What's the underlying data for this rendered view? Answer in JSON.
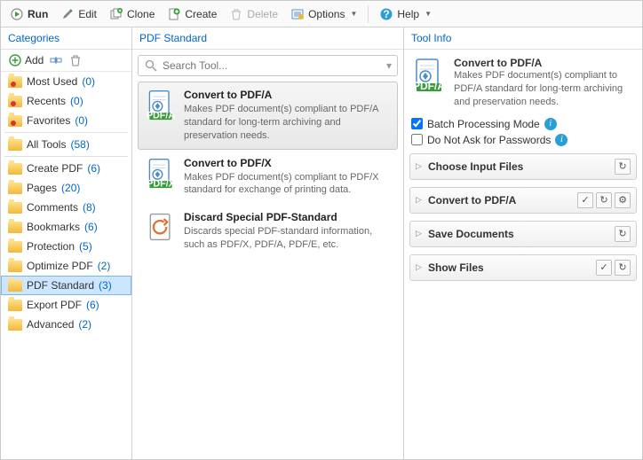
{
  "toolbar": {
    "run": "Run",
    "edit": "Edit",
    "clone": "Clone",
    "create": "Create",
    "delete": "Delete",
    "options": "Options",
    "help": "Help"
  },
  "panels": {
    "categories": "Categories",
    "standard": "PDF Standard",
    "info": "Tool Info"
  },
  "cat": {
    "add": "Add"
  },
  "categories": [
    {
      "label": "Most Used",
      "count": 0,
      "special": true
    },
    {
      "label": "Recents",
      "count": 0,
      "special": true
    },
    {
      "label": "Favorites",
      "count": 0,
      "special": true
    },
    {
      "label": "All Tools",
      "count": 58
    },
    {
      "label": "Create PDF",
      "count": 6
    },
    {
      "label": "Pages",
      "count": 20
    },
    {
      "label": "Comments",
      "count": 8
    },
    {
      "label": "Bookmarks",
      "count": 6
    },
    {
      "label": "Protection",
      "count": 5
    },
    {
      "label": "Optimize PDF",
      "count": 2
    },
    {
      "label": "PDF Standard",
      "count": 3,
      "selected": true
    },
    {
      "label": "Export PDF",
      "count": 6
    },
    {
      "label": "Advanced",
      "count": 2
    }
  ],
  "search": {
    "placeholder": "Search Tool..."
  },
  "tools": [
    {
      "title": "Convert to PDF/A",
      "desc": "Makes PDF document(s) compliant to PDF/A standard for long-term archiving and preservation needs.",
      "badge": "PDF/A",
      "selected": true
    },
    {
      "title": "Convert to PDF/X",
      "desc": "Makes PDF document(s) compliant to PDF/X standard for exchange of printing data.",
      "badge": "PDF/X"
    },
    {
      "title": "Discard Special PDF-Standard",
      "desc": "Discards special PDF-standard information, such as PDF/X, PDF/A, PDF/E, etc.",
      "badge": "discard"
    }
  ],
  "info": {
    "title": "Convert to PDF/A",
    "desc": "Makes PDF document(s) compliant to PDF/A standard for long-term archiving and preservation needs.",
    "batch": "Batch Processing Mode",
    "nopass": "Do Not Ask for Passwords"
  },
  "steps": [
    {
      "title": "Choose Input Files",
      "reset": true
    },
    {
      "title": "Convert to PDF/A",
      "check": true,
      "reset": true,
      "gear": true
    },
    {
      "title": "Save Documents",
      "reset": true
    },
    {
      "title": "Show Files",
      "check": true,
      "reset": true
    }
  ]
}
